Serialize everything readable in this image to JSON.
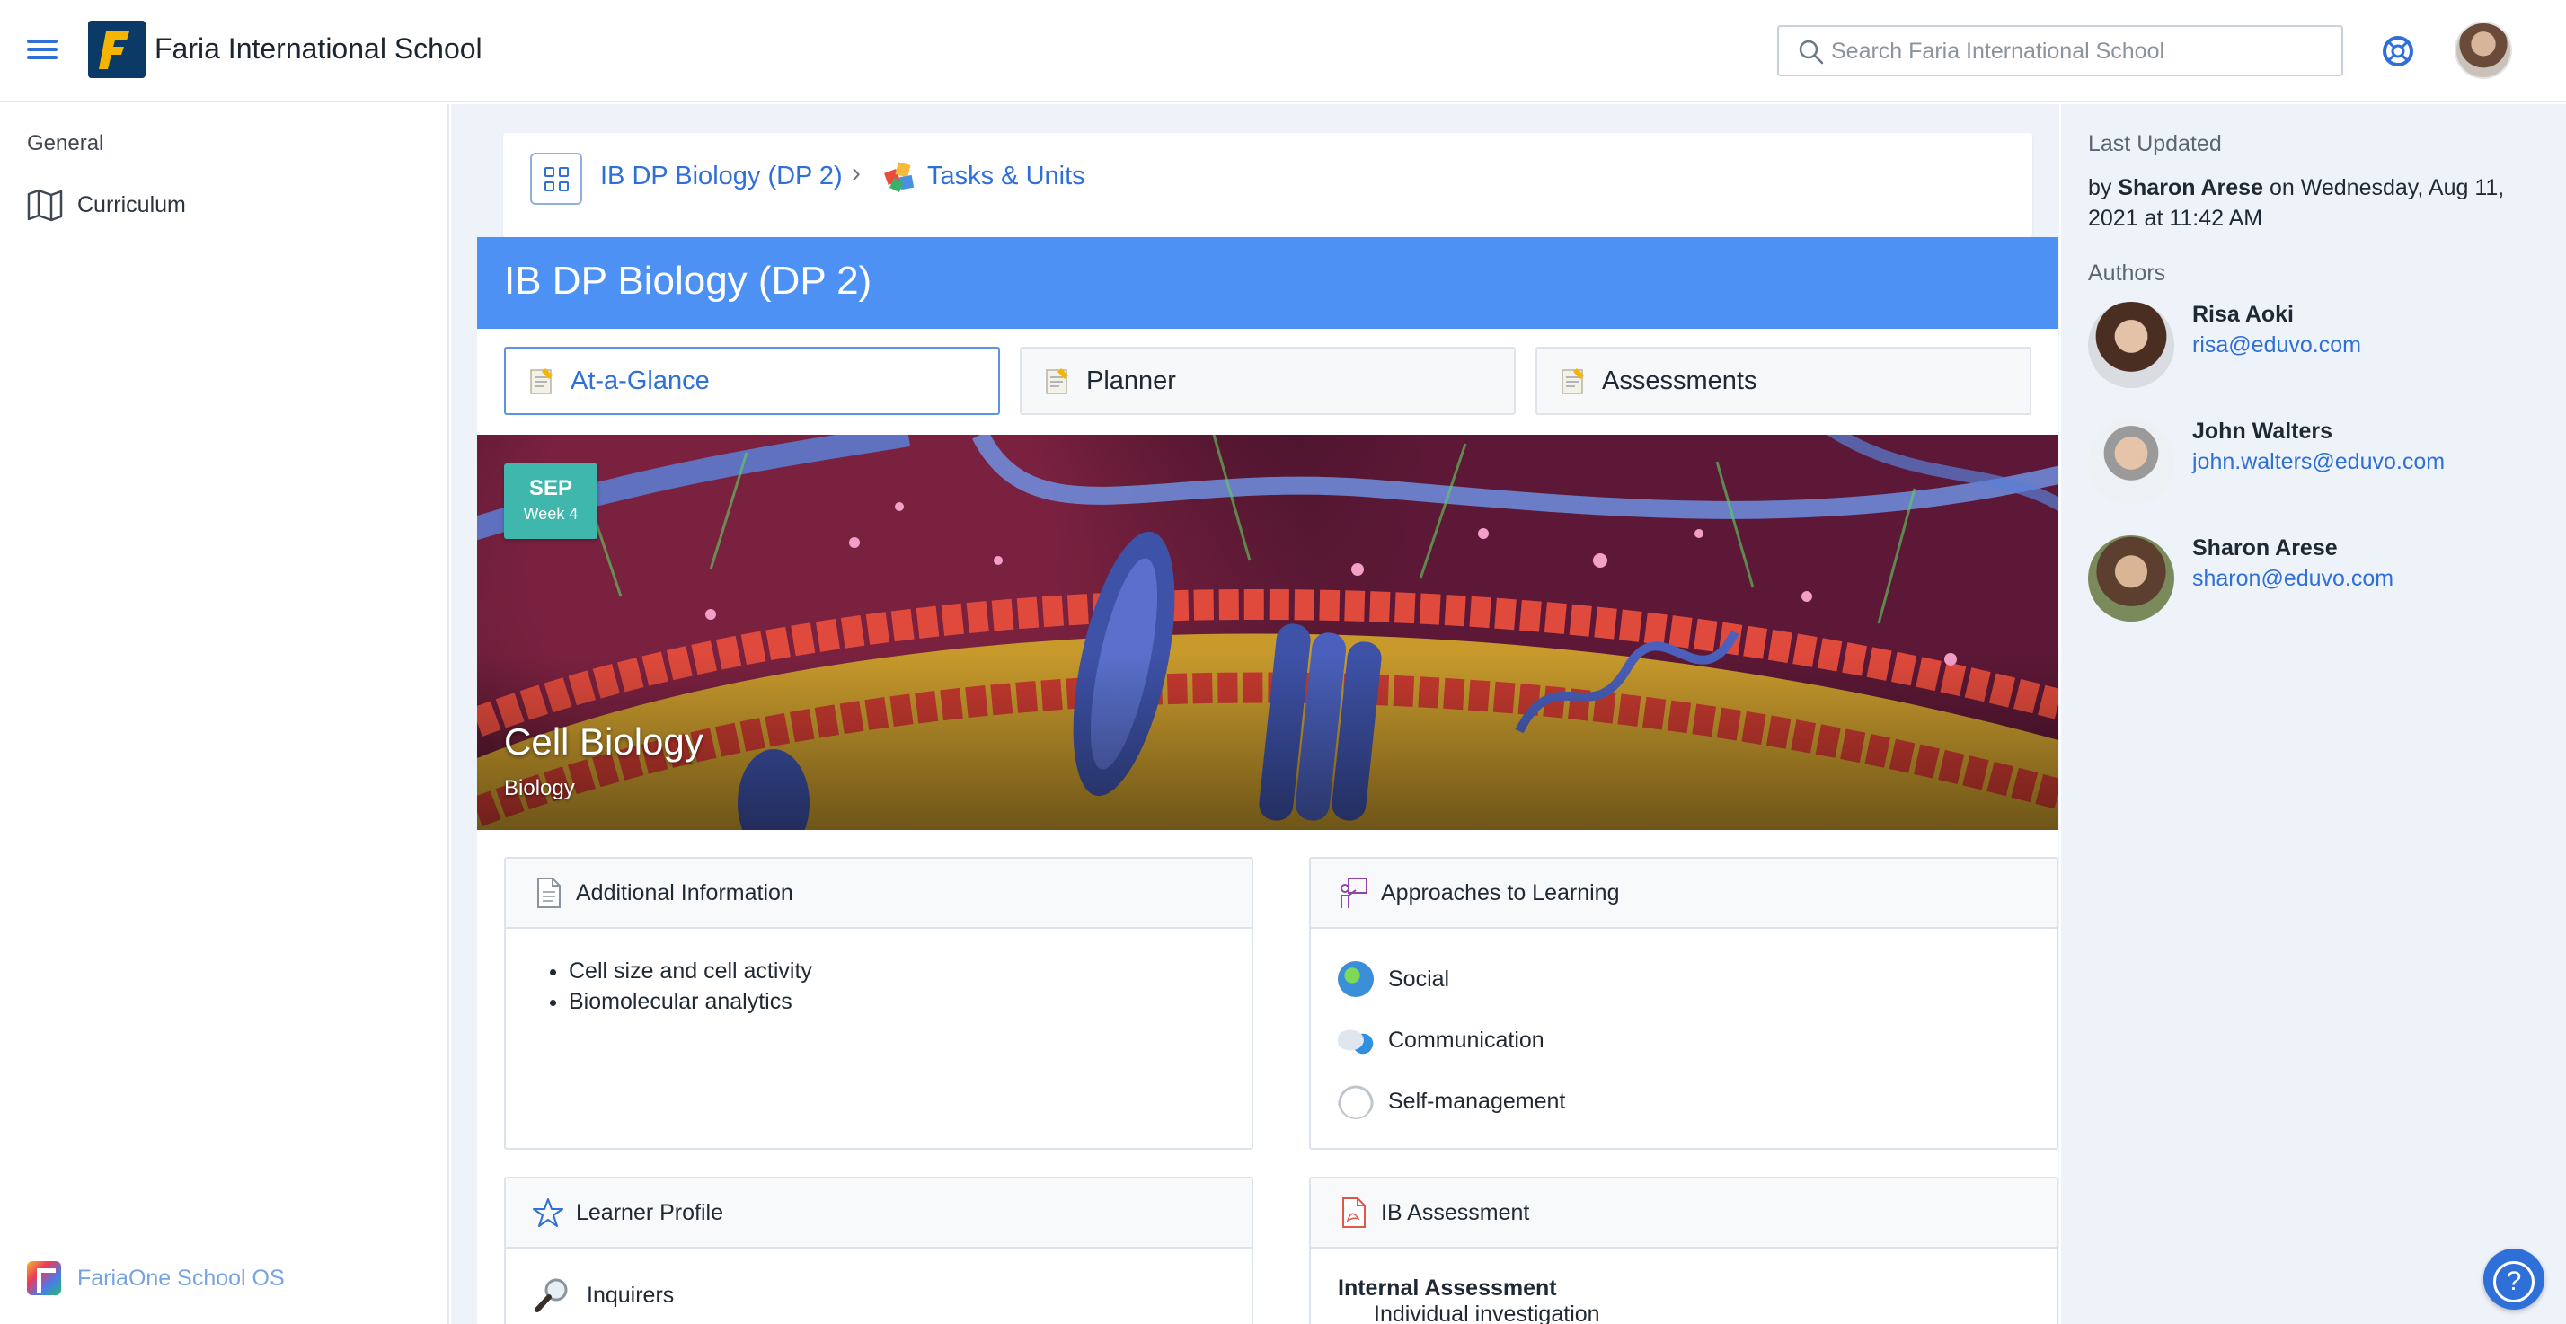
{
  "header": {
    "school_name": "Faria International School",
    "search_placeholder": "Search Faria International School"
  },
  "sidebar": {
    "heading": "General",
    "items": [
      {
        "label": "Curriculum",
        "icon": "map-icon"
      }
    ],
    "footer_label": "FariaOne School OS"
  },
  "breadcrumb": {
    "course": "IB DP Biology (DP 2)",
    "separator": ">",
    "section": "Tasks & Units"
  },
  "course": {
    "title": "IB DP Biology (DP 2)"
  },
  "tabs": [
    {
      "label": "At-a-Glance",
      "active": true
    },
    {
      "label": "Planner",
      "active": false
    },
    {
      "label": "Assessments",
      "active": false
    }
  ],
  "unit": {
    "month": "SEP",
    "week": "Week 4",
    "title": "Cell Biology",
    "subject": "Biology"
  },
  "cards": {
    "additional_info": {
      "title": "Additional Information",
      "items": [
        "Cell size and cell activity",
        "Biomolecular analytics"
      ]
    },
    "approaches": {
      "title": "Approaches to Learning",
      "items": [
        "Social",
        "Communication",
        "Self-management"
      ]
    },
    "learner_profile": {
      "title": "Learner Profile",
      "items": [
        "Inquirers"
      ]
    },
    "ib_assessment": {
      "title": "IB Assessment",
      "heading": "Internal Assessment",
      "items": [
        "Individual investigation"
      ]
    }
  },
  "right_panel": {
    "last_updated_heading": "Last Updated",
    "updated_by_prefix": "by",
    "updated_by": "Sharon Arese",
    "updated_on": "on Wednesday, Aug 11, 2021 at 11:42 AM",
    "authors_heading": "Authors",
    "authors": [
      {
        "name": "Risa Aoki",
        "email": "risa@eduvo.com"
      },
      {
        "name": "John Walters",
        "email": "john.walters@eduvo.com"
      },
      {
        "name": "Sharon Arese",
        "email": "sharon@eduvo.com"
      }
    ]
  },
  "colors": {
    "accent": "#2f6fd8",
    "banner": "#4e91f5",
    "date_badge": "#3fb7ac"
  }
}
